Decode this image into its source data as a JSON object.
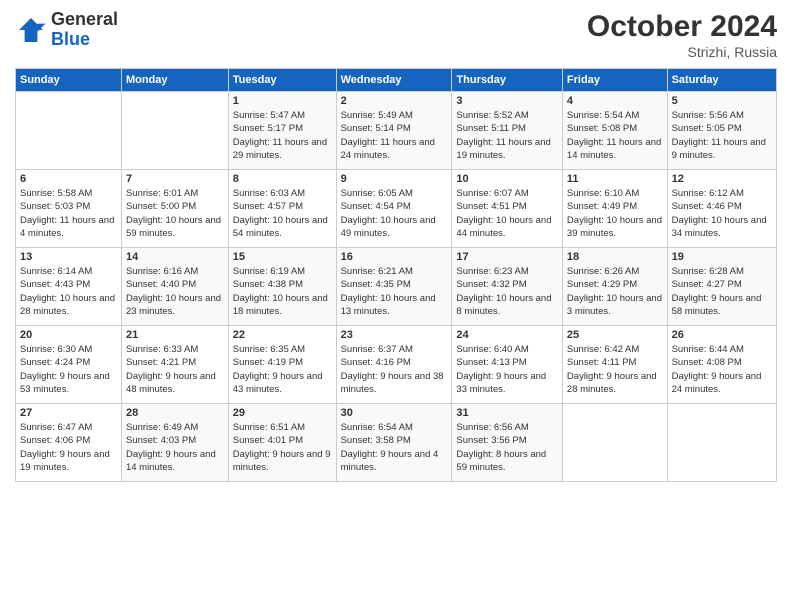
{
  "header": {
    "logo_line1": "General",
    "logo_line2": "Blue",
    "month": "October 2024",
    "location": "Strizhi, Russia"
  },
  "days_of_week": [
    "Sunday",
    "Monday",
    "Tuesday",
    "Wednesday",
    "Thursday",
    "Friday",
    "Saturday"
  ],
  "weeks": [
    [
      {
        "num": "",
        "info": ""
      },
      {
        "num": "",
        "info": ""
      },
      {
        "num": "1",
        "info": "Sunrise: 5:47 AM\nSunset: 5:17 PM\nDaylight: 11 hours and 29 minutes."
      },
      {
        "num": "2",
        "info": "Sunrise: 5:49 AM\nSunset: 5:14 PM\nDaylight: 11 hours and 24 minutes."
      },
      {
        "num": "3",
        "info": "Sunrise: 5:52 AM\nSunset: 5:11 PM\nDaylight: 11 hours and 19 minutes."
      },
      {
        "num": "4",
        "info": "Sunrise: 5:54 AM\nSunset: 5:08 PM\nDaylight: 11 hours and 14 minutes."
      },
      {
        "num": "5",
        "info": "Sunrise: 5:56 AM\nSunset: 5:05 PM\nDaylight: 11 hours and 9 minutes."
      }
    ],
    [
      {
        "num": "6",
        "info": "Sunrise: 5:58 AM\nSunset: 5:03 PM\nDaylight: 11 hours and 4 minutes."
      },
      {
        "num": "7",
        "info": "Sunrise: 6:01 AM\nSunset: 5:00 PM\nDaylight: 10 hours and 59 minutes."
      },
      {
        "num": "8",
        "info": "Sunrise: 6:03 AM\nSunset: 4:57 PM\nDaylight: 10 hours and 54 minutes."
      },
      {
        "num": "9",
        "info": "Sunrise: 6:05 AM\nSunset: 4:54 PM\nDaylight: 10 hours and 49 minutes."
      },
      {
        "num": "10",
        "info": "Sunrise: 6:07 AM\nSunset: 4:51 PM\nDaylight: 10 hours and 44 minutes."
      },
      {
        "num": "11",
        "info": "Sunrise: 6:10 AM\nSunset: 4:49 PM\nDaylight: 10 hours and 39 minutes."
      },
      {
        "num": "12",
        "info": "Sunrise: 6:12 AM\nSunset: 4:46 PM\nDaylight: 10 hours and 34 minutes."
      }
    ],
    [
      {
        "num": "13",
        "info": "Sunrise: 6:14 AM\nSunset: 4:43 PM\nDaylight: 10 hours and 28 minutes."
      },
      {
        "num": "14",
        "info": "Sunrise: 6:16 AM\nSunset: 4:40 PM\nDaylight: 10 hours and 23 minutes."
      },
      {
        "num": "15",
        "info": "Sunrise: 6:19 AM\nSunset: 4:38 PM\nDaylight: 10 hours and 18 minutes."
      },
      {
        "num": "16",
        "info": "Sunrise: 6:21 AM\nSunset: 4:35 PM\nDaylight: 10 hours and 13 minutes."
      },
      {
        "num": "17",
        "info": "Sunrise: 6:23 AM\nSunset: 4:32 PM\nDaylight: 10 hours and 8 minutes."
      },
      {
        "num": "18",
        "info": "Sunrise: 6:26 AM\nSunset: 4:29 PM\nDaylight: 10 hours and 3 minutes."
      },
      {
        "num": "19",
        "info": "Sunrise: 6:28 AM\nSunset: 4:27 PM\nDaylight: 9 hours and 58 minutes."
      }
    ],
    [
      {
        "num": "20",
        "info": "Sunrise: 6:30 AM\nSunset: 4:24 PM\nDaylight: 9 hours and 53 minutes."
      },
      {
        "num": "21",
        "info": "Sunrise: 6:33 AM\nSunset: 4:21 PM\nDaylight: 9 hours and 48 minutes."
      },
      {
        "num": "22",
        "info": "Sunrise: 6:35 AM\nSunset: 4:19 PM\nDaylight: 9 hours and 43 minutes."
      },
      {
        "num": "23",
        "info": "Sunrise: 6:37 AM\nSunset: 4:16 PM\nDaylight: 9 hours and 38 minutes."
      },
      {
        "num": "24",
        "info": "Sunrise: 6:40 AM\nSunset: 4:13 PM\nDaylight: 9 hours and 33 minutes."
      },
      {
        "num": "25",
        "info": "Sunrise: 6:42 AM\nSunset: 4:11 PM\nDaylight: 9 hours and 28 minutes."
      },
      {
        "num": "26",
        "info": "Sunrise: 6:44 AM\nSunset: 4:08 PM\nDaylight: 9 hours and 24 minutes."
      }
    ],
    [
      {
        "num": "27",
        "info": "Sunrise: 6:47 AM\nSunset: 4:06 PM\nDaylight: 9 hours and 19 minutes."
      },
      {
        "num": "28",
        "info": "Sunrise: 6:49 AM\nSunset: 4:03 PM\nDaylight: 9 hours and 14 minutes."
      },
      {
        "num": "29",
        "info": "Sunrise: 6:51 AM\nSunset: 4:01 PM\nDaylight: 9 hours and 9 minutes."
      },
      {
        "num": "30",
        "info": "Sunrise: 6:54 AM\nSunset: 3:58 PM\nDaylight: 9 hours and 4 minutes."
      },
      {
        "num": "31",
        "info": "Sunrise: 6:56 AM\nSunset: 3:56 PM\nDaylight: 8 hours and 59 minutes."
      },
      {
        "num": "",
        "info": ""
      },
      {
        "num": "",
        "info": ""
      }
    ]
  ]
}
